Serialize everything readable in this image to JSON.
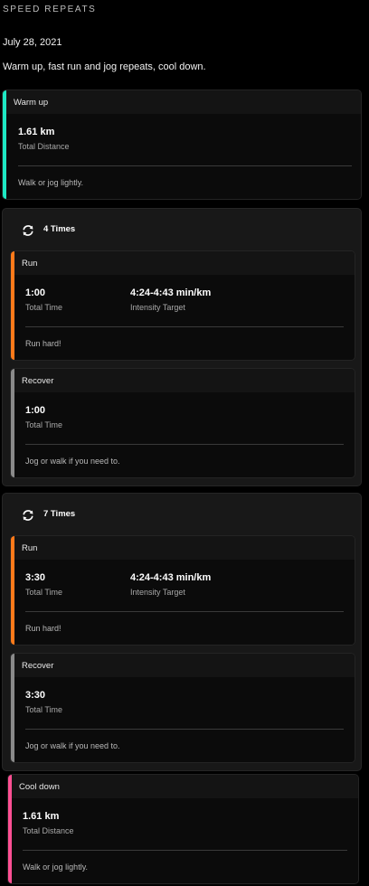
{
  "header": {
    "eyebrow": "SPEED REPEATS",
    "date": "July 28, 2021",
    "description": "Warm up, fast run and jog repeats, cool down."
  },
  "colors": {
    "warmup": "#1de9c4",
    "run": "#ff7a1a",
    "recover": "#8a8a8a",
    "cooldown": "#ff4f93"
  },
  "warmup": {
    "title": "Warm up",
    "value": "1.61 km",
    "value_label": "Total Distance",
    "note": "Walk or jog lightly."
  },
  "repeat1": {
    "label": "4 Times",
    "run": {
      "title": "Run",
      "time": "1:00",
      "time_label": "Total Time",
      "target": "4:24-4:43 min/km",
      "target_label": "Intensity Target",
      "note": "Run hard!"
    },
    "recover": {
      "title": "Recover",
      "time": "1:00",
      "time_label": "Total Time",
      "note": "Jog or walk if you need to."
    }
  },
  "repeat2": {
    "label": "7 Times",
    "run": {
      "title": "Run",
      "time": "3:30",
      "time_label": "Total Time",
      "target": "4:24-4:43 min/km",
      "target_label": "Intensity Target",
      "note": "Run hard!"
    },
    "recover": {
      "title": "Recover",
      "time": "3:30",
      "time_label": "Total Time",
      "note": "Jog or walk if you need to."
    }
  },
  "cooldown": {
    "title": "Cool down",
    "value": "1.61 km",
    "value_label": "Total Distance",
    "note": "Walk or jog lightly."
  }
}
